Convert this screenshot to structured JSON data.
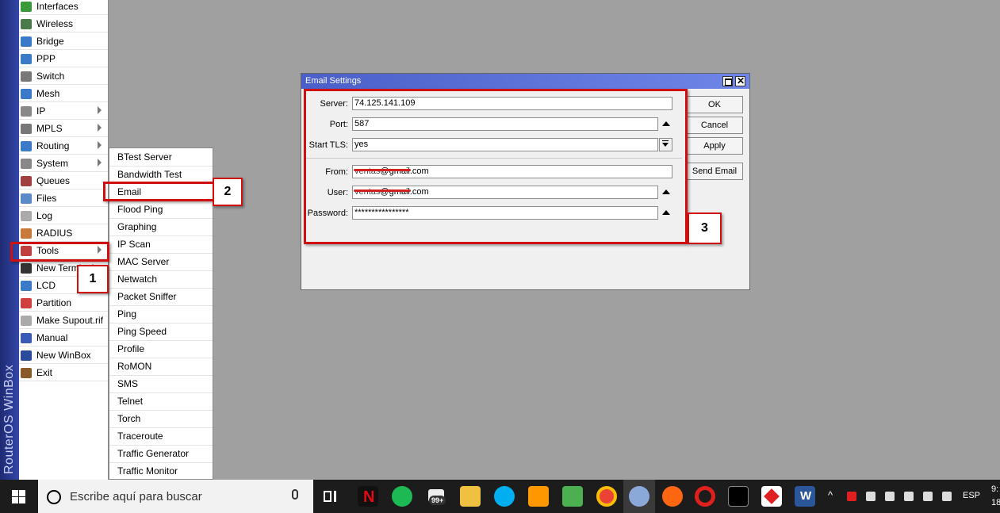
{
  "brand": "RouterOS WinBox",
  "menu": {
    "items": [
      {
        "label": "Interfaces",
        "icon": "interfaces-icon",
        "color": "#3a9a3a"
      },
      {
        "label": "Wireless",
        "icon": "wireless-icon",
        "color": "#4a7a4a"
      },
      {
        "label": "Bridge",
        "icon": "bridge-icon",
        "color": "#3a7ac8"
      },
      {
        "label": "PPP",
        "icon": "ppp-icon",
        "color": "#3a7ac8"
      },
      {
        "label": "Switch",
        "icon": "switch-icon",
        "color": "#777777"
      },
      {
        "label": "Mesh",
        "icon": "mesh-icon",
        "color": "#3a7ac8"
      },
      {
        "label": "IP",
        "icon": "ip-icon",
        "color": "#888888",
        "submenu": true
      },
      {
        "label": "MPLS",
        "icon": "mpls-icon",
        "color": "#777777",
        "submenu": true
      },
      {
        "label": "Routing",
        "icon": "routing-icon",
        "color": "#3a7ac8",
        "submenu": true
      },
      {
        "label": "System",
        "icon": "system-icon",
        "color": "#888888",
        "submenu": true
      },
      {
        "label": "Queues",
        "icon": "queues-icon",
        "color": "#a04040"
      },
      {
        "label": "Files",
        "icon": "files-icon",
        "color": "#5a8ac8"
      },
      {
        "label": "Log",
        "icon": "log-icon",
        "color": "#aaaaaa"
      },
      {
        "label": "RADIUS",
        "icon": "radius-icon",
        "color": "#c87a3a"
      },
      {
        "label": "Tools",
        "icon": "tools-icon",
        "color": "#c04040",
        "submenu": true
      },
      {
        "label": "New Terminal",
        "icon": "terminal-icon",
        "color": "#333333"
      },
      {
        "label": "LCD",
        "icon": "lcd-icon",
        "color": "#3a7ac8"
      },
      {
        "label": "Partition",
        "icon": "partition-icon",
        "color": "#d04040"
      },
      {
        "label": "Make Supout.rif",
        "icon": "supout-icon",
        "color": "#aaaaaa"
      },
      {
        "label": "Manual",
        "icon": "manual-icon",
        "color": "#3a5ab8"
      },
      {
        "label": "New WinBox",
        "icon": "winbox-icon",
        "color": "#2a4a9a"
      },
      {
        "label": "Exit",
        "icon": "exit-icon",
        "color": "#8a5a2a"
      }
    ]
  },
  "submenu": {
    "items": [
      "BTest Server",
      "Bandwidth Test",
      "Email",
      "Flood Ping",
      "Graphing",
      "IP Scan",
      "MAC Server",
      "Netwatch",
      "Packet Sniffer",
      "Ping",
      "Ping Speed",
      "Profile",
      "RoMON",
      "SMS",
      "Telnet",
      "Torch",
      "Traceroute",
      "Traffic Generator",
      "Traffic Monitor"
    ]
  },
  "annotations": {
    "one": "1",
    "two": "2",
    "three": "3"
  },
  "dialog": {
    "title": "Email Settings",
    "server_label": "Server:",
    "server_value": "74.125.141.109",
    "port_label": "Port:",
    "port_value": "587",
    "tls_label": "Start TLS:",
    "tls_value": "yes",
    "from_label": "From:",
    "from_redacted": "ventas",
    "from_value": "@gmail.com",
    "user_label": "User:",
    "user_redacted": "ventas",
    "user_value": "@gmail.com",
    "password_label": "Password:",
    "password_value": "****************",
    "ok_label": "OK",
    "cancel_label": "Cancel",
    "apply_label": "Apply",
    "send_label": "Send Email"
  },
  "taskbar": {
    "search_placeholder": "Escribe aquí para buscar",
    "badge": "99+",
    "lang": "ESP",
    "clock_line1": "9:",
    "clock_line2": "18"
  }
}
